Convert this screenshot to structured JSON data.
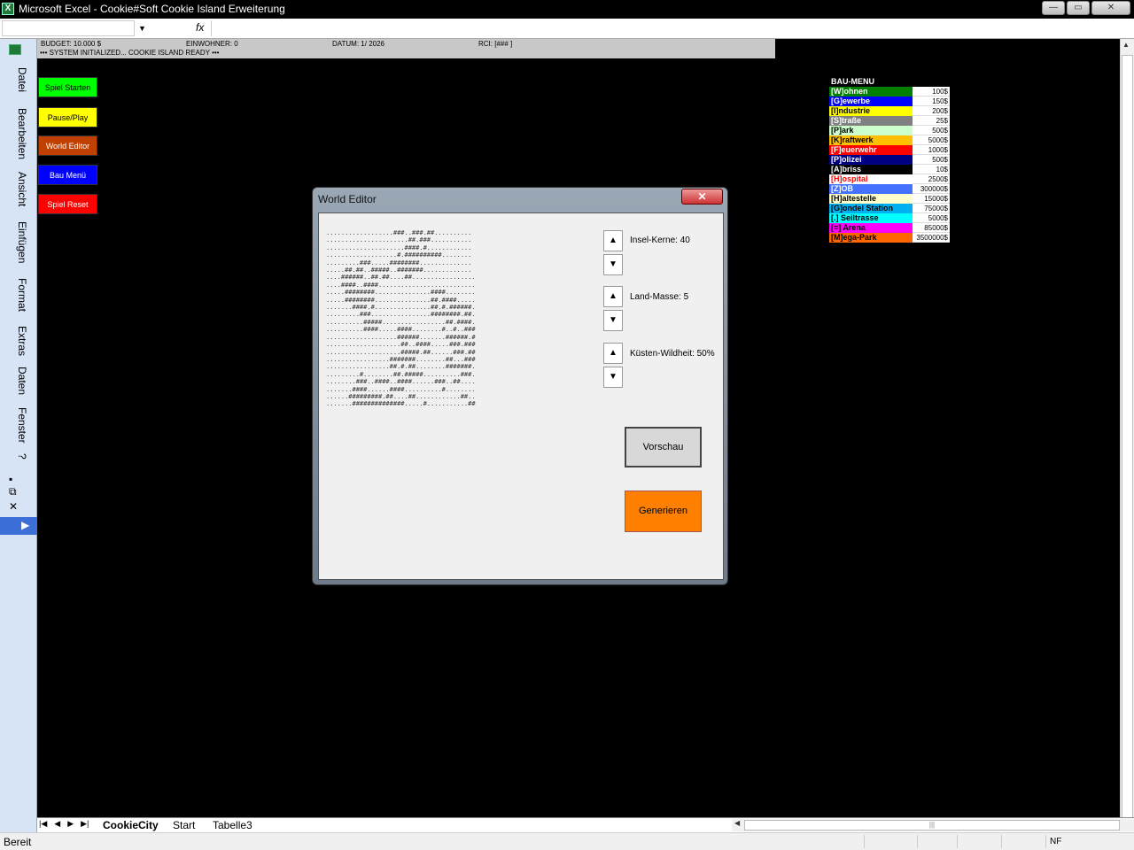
{
  "window": {
    "title": "Microsoft Excel - Cookie#Soft Cookie Island Erweiterung",
    "controls": [
      "—",
      "▭",
      "✕"
    ]
  },
  "formula_bar": {
    "fx_label": "fx",
    "dropdown_glyph": "▼"
  },
  "left_menu": [
    "Datei",
    "Bearbeiten",
    "Ansicht",
    "Einfügen",
    "Format",
    "Extras",
    "Daten",
    "Fenster",
    "?"
  ],
  "left_menu_icons": [
    "minimize-icon",
    "restore-icon",
    "close-icon",
    "expand-icon"
  ],
  "status_strip": {
    "budget": "BUDGET: 10.000 $",
    "einwohner": "EINWOHNER: 0",
    "datum": "DATUM: 1/ 2026",
    "rci": "RCI: [###  ]",
    "message": "••• SYSTEM INITIALIZED... COOKIE ISLAND READY •••"
  },
  "game_buttons": [
    {
      "label": "Spiel Starten",
      "bg": "#00ff00",
      "fg": "#000000"
    },
    {
      "label": "Pause/Play",
      "bg": "#ffff00",
      "fg": "#000000"
    },
    {
      "label": "World Editor",
      "bg": "#c04000",
      "fg": "#ffffff"
    },
    {
      "label": "Bau Menü",
      "bg": "#0000ff",
      "fg": "#ffffff"
    },
    {
      "label": "Spiel Reset",
      "bg": "#ff0000",
      "fg": "#ffffff"
    }
  ],
  "bau_menu": {
    "title": "BAU-MENU",
    "items": [
      {
        "label": "[W]ohnen",
        "price": "100$",
        "bg": "#008000",
        "fg": "#ffffff"
      },
      {
        "label": "[G]ewerbe",
        "price": "150$",
        "bg": "#0000ff",
        "fg": "#ffffff"
      },
      {
        "label": "[I]ndustrie",
        "price": "200$",
        "bg": "#ffff00",
        "fg": "#000000"
      },
      {
        "label": "[S]traße",
        "price": "25$",
        "bg": "#808080",
        "fg": "#ffffff"
      },
      {
        "label": "[P]ark",
        "price": "500$",
        "bg": "#ccffcc",
        "fg": "#000000"
      },
      {
        "label": "[K]raftwerk",
        "price": "5000$",
        "bg": "#ffc000",
        "fg": "#000000"
      },
      {
        "label": "[F]euerwehr",
        "price": "1000$",
        "bg": "#ff0000",
        "fg": "#ffffff"
      },
      {
        "label": "[P]olizei",
        "price": "500$",
        "bg": "#000080",
        "fg": "#ffffff"
      },
      {
        "label": "[A]briss",
        "price": "10$",
        "bg": "#000000",
        "fg": "#ffffff"
      },
      {
        "label": "[H]ospital",
        "price": "2500$",
        "bg": "#ffffff",
        "fg": "#ff0000"
      },
      {
        "label": "[Z]OB",
        "price": "300000$",
        "bg": "#4472ff",
        "fg": "#ffffff"
      },
      {
        "label": "[H]altestelle",
        "price": "15000$",
        "bg": "#ffffcc",
        "fg": "#000000"
      },
      {
        "label": "[G]ondel Station",
        "price": "75000$",
        "bg": "#00b0f0",
        "fg": "#000000"
      },
      {
        "label": "[.] Seiltrasse",
        "price": "5000$",
        "bg": "#00ffff",
        "fg": "#000000"
      },
      {
        "label": "[=] Arena",
        "price": "85000$",
        "bg": "#ff00ff",
        "fg": "#000000"
      },
      {
        "label": "[M]ega-Park",
        "price": "3500000$",
        "bg": "#ff6600",
        "fg": "#000000"
      }
    ]
  },
  "dialog": {
    "title": "World Editor",
    "close": "✕",
    "ascii_map": "..................###..###.##..........\n......................##.###...........\n.....................####.#............\n...................#.##########........\n.........###.....########..............\n.....##.##..#####..#######.............\n....######..##.##....##.................\n....####..####..........................\n.....########...............####........\n.....########...............##.####.....\n.......####.#...............##.#.######.\n.........###................########.##.\n..........#####.................##.####.\n..........####.....####........#..#..###\n...................######.......######.#\n....................##..####.....###.###\n....................#####.##......###.##\n.................#######........##...###\n.................##.#.##........#######.\n.........#........##.#####..........###.\n........###..####..####......###..##....\n.......####......####..........#........\n......#########.##....##............##..\n.......##############.....#...........##",
    "spinners": [
      {
        "label": "Insel-Kerne: 40"
      },
      {
        "label": "Land-Masse: 5"
      },
      {
        "label": "Küsten-Wildheit: 50%"
      }
    ],
    "up": "▲",
    "down": "▼",
    "vorschau": "Vorschau",
    "generieren": "Generieren"
  },
  "sheet_tabs": [
    "CookieCity",
    "Start",
    "Tabelle3"
  ],
  "tab_nav": [
    "|◀",
    "◀",
    "▶",
    "▶|"
  ],
  "status_bar": {
    "ready": "Bereit",
    "nf": "NF"
  }
}
